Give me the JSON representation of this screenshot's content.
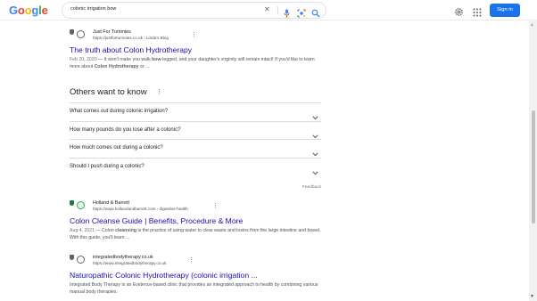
{
  "header": {
    "logo_letters": [
      {
        "char": "G",
        "color": "#4285f4"
      },
      {
        "char": "o",
        "color": "#ea4335"
      },
      {
        "char": "o",
        "color": "#fbbc05"
      },
      {
        "char": "g",
        "color": "#4285f4"
      },
      {
        "char": "l",
        "color": "#34a853"
      },
      {
        "char": "e",
        "color": "#ea4335"
      }
    ],
    "search_query": "colonic irrigation bow",
    "clear_icon": "close-icon",
    "signin_label": "Sign in"
  },
  "results": [
    {
      "site_name": "Just For Tummies",
      "url": "https://justfortummies.co.uk › Linda's Blog",
      "title": "The truth about Colon Hydrotherapy",
      "date": "Feb 20, 2020",
      "snippet_parts": [
        {
          "t": " — It won't make you walk ",
          "b": false
        },
        {
          "t": "bow",
          "b": true
        },
        {
          "t": "-legged, and your daughter's virginity will remain intact! If you'd like to learn more about ",
          "b": false
        },
        {
          "t": "Colon Hydrotherapy",
          "b": true
        },
        {
          "t": " or ...",
          "b": false
        }
      ]
    },
    {
      "site_name": "Holland & Barrett",
      "url": "https://www.hollandandbarrett.com › digestive-health",
      "title": "Colon Cleanse Guide | Benefits, Procedure & More",
      "date": "Aug 4, 2021",
      "snippet_parts": [
        {
          "t": " — Colon ",
          "b": false
        },
        {
          "t": "cleansing",
          "b": true
        },
        {
          "t": " is the practice of using water to clear waste and toxins from the large intestine and bowel. With this guide, you'll learn ...",
          "b": false
        }
      ]
    },
    {
      "site_name": "integratedbodytherapy.co.uk",
      "url": "https://www.integratedbodytherapy.co.uk",
      "title": "Naturopathic Colonic Hydrotherapy (colonic irrigation ...",
      "date": "",
      "snippet_parts": [
        {
          "t": "Integrated Body Therapy is an Evidence-based clinic that provides an integrated approach to health by combining various manual body therapies.",
          "b": false
        }
      ]
    }
  ],
  "paa": {
    "title": "Others want to know",
    "questions": [
      "What comes out during colonic irrigation?",
      "How many pounds do you lose after a colonic?",
      "How much comes out during a colonic?",
      "Should I push during a colonic?"
    ],
    "feedback": "Feedback"
  },
  "colors": {
    "link": "#1a0dab",
    "accent": "#1a73e8",
    "text": "#202124",
    "secondary": "#4d5156"
  }
}
